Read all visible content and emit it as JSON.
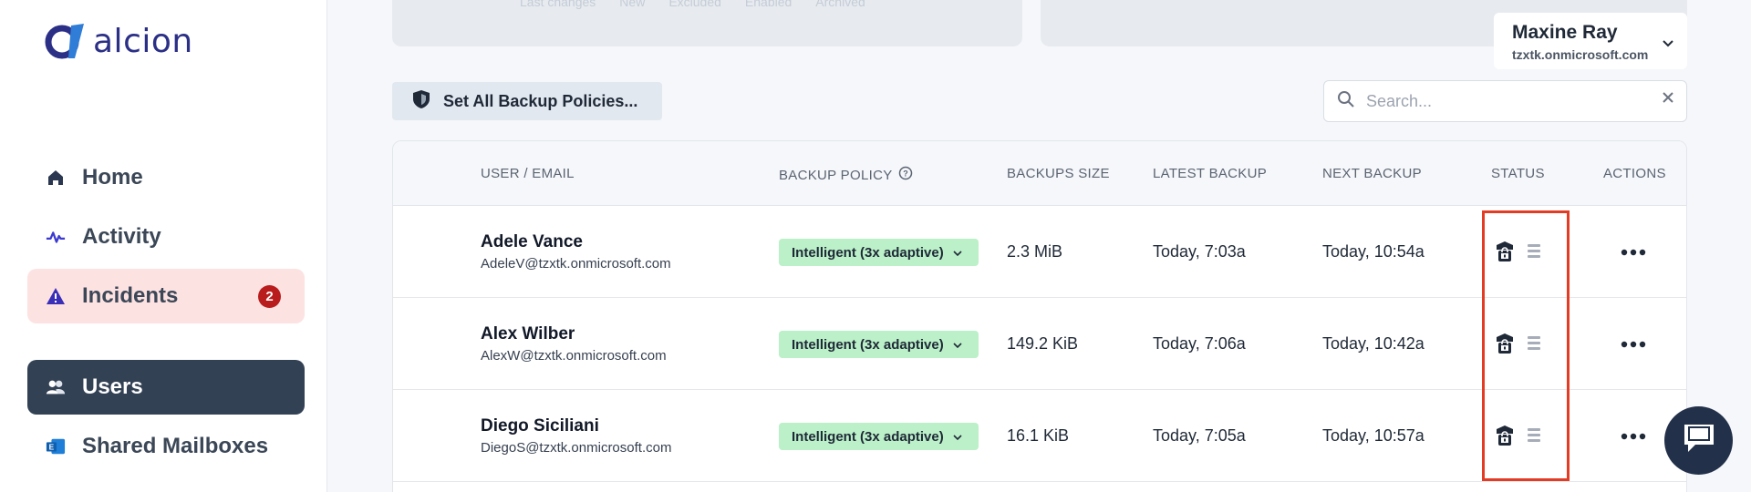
{
  "brand": {
    "name": "alcion",
    "color": "#2b2f86",
    "accent": "#2f7dd6"
  },
  "sidebar": {
    "items": [
      {
        "label": "Home",
        "icon": "home-icon"
      },
      {
        "label": "Activity",
        "icon": "activity-icon"
      },
      {
        "label": "Incidents",
        "icon": "warning-icon",
        "badge": "2"
      },
      {
        "label": "Users",
        "icon": "users-icon",
        "active": true
      },
      {
        "label": "Shared Mailboxes",
        "icon": "exchange-icon"
      }
    ]
  },
  "top_panel": {
    "faded_labels": [
      "Last changes",
      "New",
      "Excluded",
      "Enabled",
      "Archived"
    ]
  },
  "user_menu": {
    "name": "Maxine Ray",
    "domain": "tzxtk.onmicrosoft.com"
  },
  "toolbar": {
    "set_policies_label": "Set All Backup Policies..."
  },
  "search": {
    "placeholder": "Search...",
    "value": ""
  },
  "table": {
    "headers": {
      "user": "USER / EMAIL",
      "policy": "BACKUP POLICY",
      "size": "BACKUPS SIZE",
      "latest": "LATEST BACKUP",
      "next": "NEXT BACKUP",
      "status": "STATUS",
      "actions": "ACTIONS"
    },
    "rows": [
      {
        "name": "Adele Vance",
        "email": "AdeleV@tzxtk.onmicrosoft.com",
        "policy": "Intelligent (3x adaptive)",
        "size": "2.3 MiB",
        "latest": "Today, 7:03a",
        "next": "Today, 10:54a"
      },
      {
        "name": "Alex Wilber",
        "email": "AlexW@tzxtk.onmicrosoft.com",
        "policy": "Intelligent (3x adaptive)",
        "size": "149.2 KiB",
        "latest": "Today, 7:06a",
        "next": "Today, 10:42a"
      },
      {
        "name": "Diego Siciliani",
        "email": "DiegoS@tzxtk.onmicrosoft.com",
        "policy": "Intelligent (3x adaptive)",
        "size": "16.1 KiB",
        "latest": "Today, 7:05a",
        "next": "Today, 10:57a"
      }
    ]
  },
  "colors": {
    "policy_bg": "#bbf0c8",
    "active_nav": "#334155",
    "incident_bg": "#fde2e2",
    "badge": "#b91c1c",
    "highlight": "#e33b24"
  }
}
